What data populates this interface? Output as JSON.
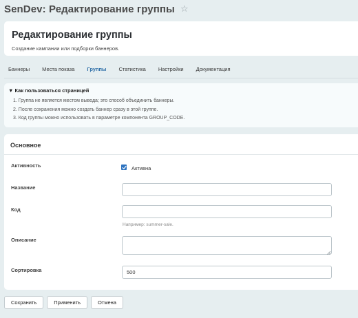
{
  "window": {
    "title": "SenDev: Редактирование группы",
    "star_icon": "star-outline-icon"
  },
  "header": {
    "title": "Редактирование группы",
    "subtitle": "Создание кампании или подборки баннеров."
  },
  "tabs": [
    {
      "label": "Баннеры",
      "active": false
    },
    {
      "label": "Места показа",
      "active": false
    },
    {
      "label": "Группы",
      "active": true
    },
    {
      "label": "Статистика",
      "active": false
    },
    {
      "label": "Настройки",
      "active": false
    },
    {
      "label": "Документация",
      "active": false
    }
  ],
  "help": {
    "title": "▼ Как пользоваться страницей",
    "items": [
      "1. Группа не является местом вывода; это способ объединить баннеры.",
      "2. После сохранения можно создать баннер сразу в этой группе.",
      "3. Код группы можно использовать в параметре компонента GROUP_CODE."
    ]
  },
  "form": {
    "section_title": "Основное",
    "active_label": "Активность",
    "active_checkbox_label": "Активна",
    "active_checked": true,
    "name_label": "Название",
    "name_value": "",
    "code_label": "Код",
    "code_value": "",
    "code_hint": "Например: summer-sale.",
    "description_label": "Описание",
    "description_value": "",
    "sort_label": "Сортировка",
    "sort_value": "500"
  },
  "buttons": {
    "save": "Сохранить",
    "apply": "Применить",
    "cancel": "Отмена"
  },
  "colors": {
    "accent": "#2f74c0",
    "active_tab": "#2f6fa8",
    "background": "#e6eef0"
  }
}
